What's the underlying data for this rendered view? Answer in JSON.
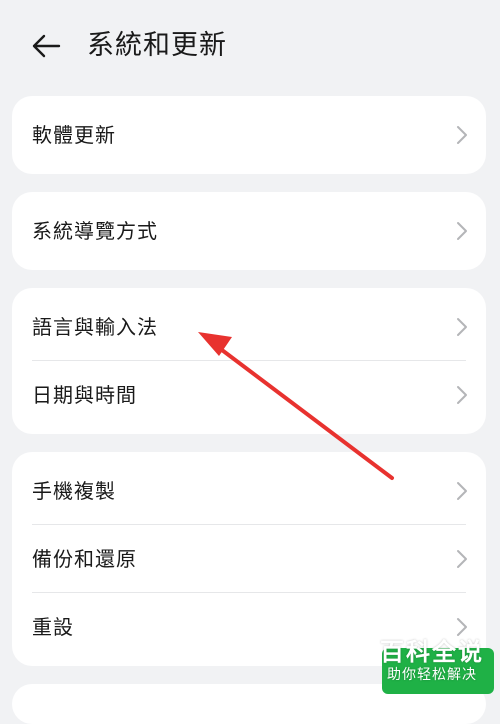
{
  "header": {
    "title": "系統和更新",
    "back_icon": "arrow-left-icon"
  },
  "groups": [
    {
      "items": [
        {
          "label": "軟體更新"
        }
      ]
    },
    {
      "items": [
        {
          "label": "系統導覽方式"
        }
      ]
    },
    {
      "items": [
        {
          "label": "語言與輸入法"
        },
        {
          "label": "日期與時間"
        }
      ]
    },
    {
      "items": [
        {
          "label": "手機複製"
        },
        {
          "label": "備份和還原"
        },
        {
          "label": "重設"
        }
      ]
    }
  ],
  "annotation": {
    "color": "#e8322f"
  },
  "watermark": {
    "title": "百科全说",
    "subtitle": "助你轻松解决",
    "color": "#1fb146"
  },
  "colors": {
    "background": "#f1f2f4",
    "card": "#ffffff",
    "text": "#1a1a1a",
    "chevron": "#b4b5b8"
  }
}
